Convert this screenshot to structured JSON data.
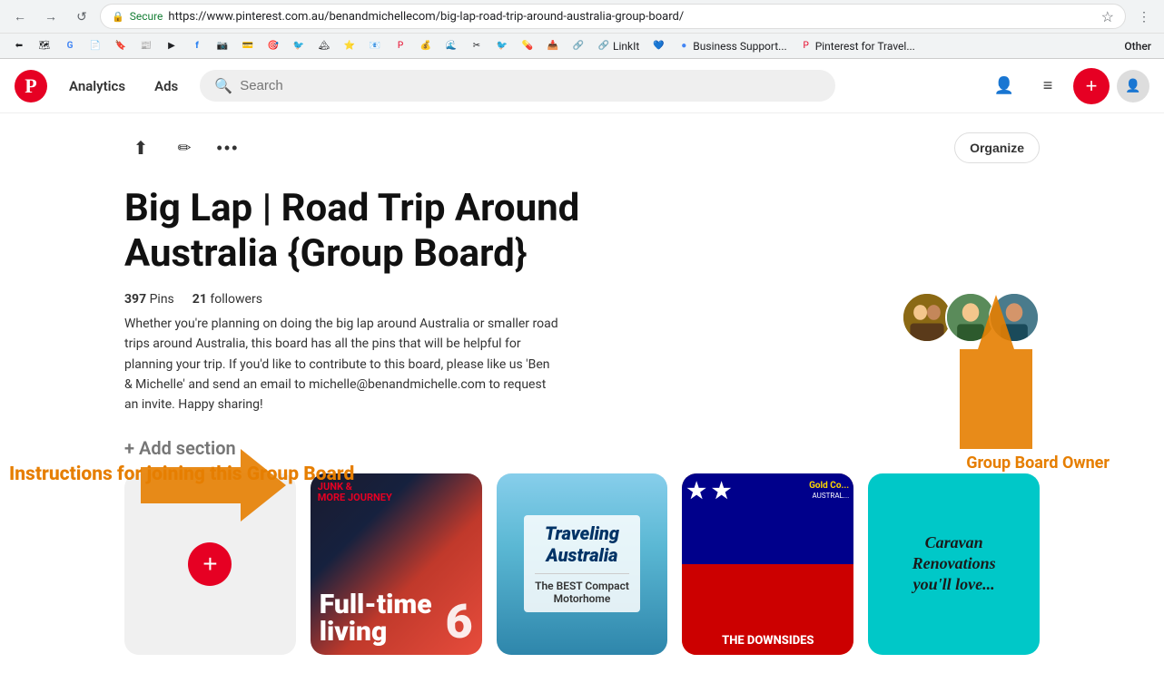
{
  "browser": {
    "address": "https://www.pinterest.com.au/benandmichellecom/big-lap-road-trip-around-australia-group-board/",
    "protocol": "Secure",
    "back_label": "←",
    "forward_label": "→",
    "refresh_label": "↺",
    "bookmark_label": "☆",
    "menu_label": "⋮",
    "bookmarks": [
      {
        "label": "",
        "icon": "🔙"
      },
      {
        "label": "",
        "icon": "🗺"
      },
      {
        "label": "",
        "icon": "G"
      },
      {
        "label": "",
        "icon": "📄"
      },
      {
        "label": "",
        "icon": "🔖"
      },
      {
        "label": "",
        "icon": "📰"
      },
      {
        "label": "",
        "icon": "▶"
      },
      {
        "label": "",
        "icon": "📘"
      },
      {
        "label": "",
        "icon": "📷"
      },
      {
        "label": "",
        "icon": "💳"
      },
      {
        "label": "",
        "icon": "🎯"
      },
      {
        "label": "",
        "icon": "🐦"
      },
      {
        "label": "",
        "icon": "🏔"
      },
      {
        "label": "",
        "icon": "⭐"
      },
      {
        "label": "",
        "icon": "📧"
      },
      {
        "label": "",
        "icon": "📌"
      },
      {
        "label": "",
        "icon": "💰"
      },
      {
        "label": "",
        "icon": "🌊"
      },
      {
        "label": "",
        "icon": "✂"
      },
      {
        "label": "",
        "icon": "🐦"
      },
      {
        "label": "",
        "icon": "💊"
      },
      {
        "label": "",
        "icon": "📥"
      },
      {
        "label": "",
        "icon": "🔗"
      },
      {
        "label": "LinkIt",
        "icon": "🔗"
      },
      {
        "label": "",
        "icon": "💙"
      },
      {
        "label": "Business Support...",
        "icon": "🔵"
      },
      {
        "label": "Pinterest for Travel...",
        "icon": "📌"
      }
    ],
    "other_label": "Other"
  },
  "header": {
    "logo_letter": "P",
    "analytics_label": "Analytics",
    "ads_label": "Ads",
    "search_placeholder": "Search",
    "user_icon": "👤",
    "menu_icon": "≡",
    "add_icon": "+"
  },
  "board": {
    "title": "Big Lap | Road Trip Around Australia {Group Board}",
    "pins_count": "397",
    "pins_label": "Pins",
    "followers_count": "21",
    "followers_label": "followers",
    "description": "Whether you're planning on doing the big lap around Australia or smaller road trips around Australia, this board has all the pins that will be helpful for planning your trip. If you'd like to contribute to this board, please like us 'Ben & Michelle' and send an email to michelle@benandmichelle.com to request an invite. Happy sharing!",
    "organize_label": "Organize",
    "add_section_label": "+ Add section",
    "upload_icon": "⬆",
    "edit_icon": "✏",
    "more_icon": "•••"
  },
  "overlay": {
    "instructions_label": "Instructions for joining this Group Board",
    "group_owner_label": "Group Board Owner"
  },
  "pins": [
    {
      "id": "add",
      "type": "add"
    },
    {
      "id": "pin1",
      "type": "rv",
      "main_text": "Full-time\nliving",
      "number": "6",
      "sub_text": "More Journey"
    },
    {
      "id": "pin2",
      "type": "australia",
      "title": "Traveling Australia",
      "sub_text": "The BEST Compact Motorhome"
    },
    {
      "id": "pin3",
      "type": "flags",
      "title": "THE DOWNSIDES"
    },
    {
      "id": "pin4",
      "type": "caravan",
      "title": "Caravan Renovations you'll love..."
    }
  ]
}
